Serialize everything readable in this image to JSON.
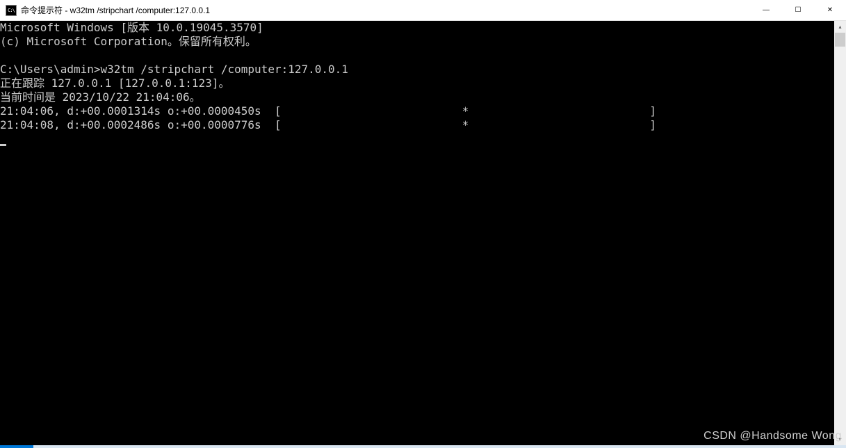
{
  "titlebar": {
    "icon_label": "C:\\",
    "title": "命令提示符 - w32tm  /stripchart /computer:127.0.0.1",
    "minimize": "—",
    "maximize": "☐",
    "close": "✕"
  },
  "console": {
    "lines": [
      "Microsoft Windows [版本 10.0.19045.3570]",
      "(c) Microsoft Corporation。保留所有权利。",
      "",
      "C:\\Users\\admin>w32tm /stripchart /computer:127.0.0.1",
      "正在跟踪 127.0.0.1 [127.0.0.1:123]。",
      "当前时间是 2023/10/22 21:04:06。",
      "21:04:06, d:+00.0001314s o:+00.0000450s  [                           *                           ]",
      "21:04:08, d:+00.0002486s o:+00.0000776s  [                           *                           ]"
    ]
  },
  "scrollbar": {
    "up_arrow": "▴",
    "down_arrow": "▾"
  },
  "watermark": "CSDN @Handsome  Wong"
}
